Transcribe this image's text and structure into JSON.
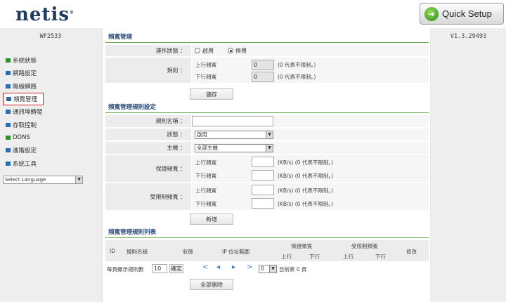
{
  "brand": {
    "logo": "netis",
    "trademark": "®"
  },
  "quick_setup": {
    "label": "Quick Setup",
    "icon": "go-arrow-icon"
  },
  "model": "WF2533",
  "version": "V1.3.29493",
  "sidebar": {
    "items": [
      {
        "label": "系統狀態",
        "color": "#2c8f2c"
      },
      {
        "label": "網路設定",
        "color": "#2b6cb0"
      },
      {
        "label": "無線網路",
        "color": "#2b6cb0"
      },
      {
        "label": "頻寬管理",
        "color": "#2b6cb0",
        "active": true
      },
      {
        "label": "通訊埠轉發",
        "color": "#2b6cb0"
      },
      {
        "label": "存取控制",
        "color": "#2b6cb0"
      },
      {
        "label": "DDNS",
        "color": "#2c8f2c"
      },
      {
        "label": "進階設定",
        "color": "#2b6cb0"
      },
      {
        "label": "系統工具",
        "color": "#2b6cb0"
      }
    ],
    "language": "Select Language"
  },
  "section1": {
    "title": "頻寬管理",
    "status_label": "運作狀態 ：",
    "enable": "啟用",
    "disable": "停用",
    "rule_label": "規則 ：",
    "upload_label": "上行頻寬",
    "download_label": "下行頻寬",
    "upload_value": "0",
    "download_value": "0",
    "hint": "(0 代表不限制。)",
    "save": "儲存"
  },
  "section2": {
    "title": "頻寬管理規則設定",
    "name_label": "規則名稱 ：",
    "status_label": "狀態 ：",
    "status_value": "啟用",
    "host_label": "主機 ：",
    "host_value": "全部主機",
    "guaranteed_label": "保證頻寬 ：",
    "limit_label": "受限制頻寬 ：",
    "upload_label": "上行頻寬",
    "download_label": "下行頻寬",
    "unit_hint": "(KB/s) (0 代表不限制。)",
    "add": "新增"
  },
  "section3": {
    "title": "頻寬管理規則列表",
    "columns": {
      "id": "ID",
      "name": "規則名稱",
      "status": "狀態",
      "ip": "IP 位址範圍",
      "guaranteed": "保證頻寬",
      "limited": "受限制頻寬",
      "up": "上行",
      "down": "下行",
      "edit": "修改"
    },
    "per_page_label": "每頁顯示規則數",
    "per_page_value": "10",
    "confirm": "確定",
    "page_value": "0",
    "current_page": "目前第 0 頁",
    "delete_all": "全部刪除"
  }
}
